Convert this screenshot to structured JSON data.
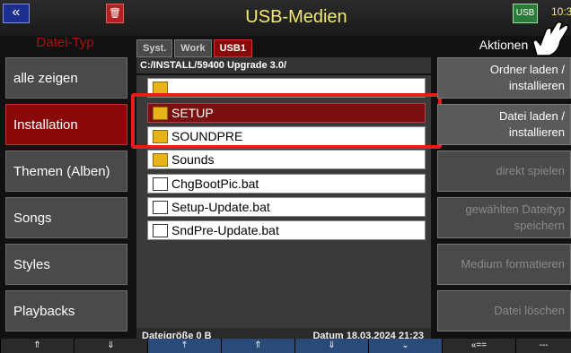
{
  "header": {
    "title": "USB-Medien",
    "clock": "10:3",
    "back_glyph": "«",
    "trash_glyph": "🗑",
    "usb_glyph": "USB"
  },
  "left": {
    "heading": "Datei-Typ",
    "items": [
      {
        "label": "alle zeigen",
        "active": false
      },
      {
        "label": "Installation",
        "active": true
      },
      {
        "label": "Themen (Alben)",
        "active": false
      },
      {
        "label": "Songs",
        "active": false
      },
      {
        "label": "Styles",
        "active": false
      },
      {
        "label": "Playbacks",
        "active": false
      }
    ]
  },
  "tabs": [
    {
      "label": "Syst.",
      "active": false
    },
    {
      "label": "Work",
      "active": false
    },
    {
      "label": "USB1",
      "active": true
    }
  ],
  "path": "C:/INSTALL/59400 Upgrade 3.0/",
  "files": [
    {
      "name": "",
      "type": "up-folder",
      "selected": false
    },
    {
      "name": "SETUP",
      "type": "folder",
      "selected": true
    },
    {
      "name": "SOUNDPRE",
      "type": "folder",
      "selected": false
    },
    {
      "name": "Sounds",
      "type": "folder",
      "selected": false
    },
    {
      "name": "ChgBootPic.bat",
      "type": "file",
      "selected": false
    },
    {
      "name": "Setup-Update.bat",
      "type": "file",
      "selected": false
    },
    {
      "name": "SndPre-Update.bat",
      "type": "file",
      "selected": false
    }
  ],
  "status": {
    "size": "Dateigröße 0 B",
    "date": "Datum 18.03.2024  21:23"
  },
  "right": {
    "heading": "Aktionen",
    "items": [
      {
        "line1": "Ordner laden  /",
        "line2": "installieren",
        "dim": false
      },
      {
        "line1": "Datei laden  /",
        "line2": "installieren",
        "dim": false
      },
      {
        "line1": "direkt spielen",
        "line2": "",
        "dim": true
      },
      {
        "line1": "gewählten Dateityp",
        "line2": "speichern",
        "dim": true
      },
      {
        "line1": "Medium formatieren",
        "line2": "",
        "dim": true
      },
      {
        "line1": "Datei löschen",
        "line2": "",
        "dim": true
      }
    ]
  },
  "bottom": [
    "⇑",
    "⇓",
    "⤒",
    "⇑",
    "⇓",
    "⌄",
    "«==",
    "---"
  ],
  "colors": {
    "accent": "#8a0a0a",
    "title": "#f3e96a",
    "highlight": "#e81c1c"
  }
}
